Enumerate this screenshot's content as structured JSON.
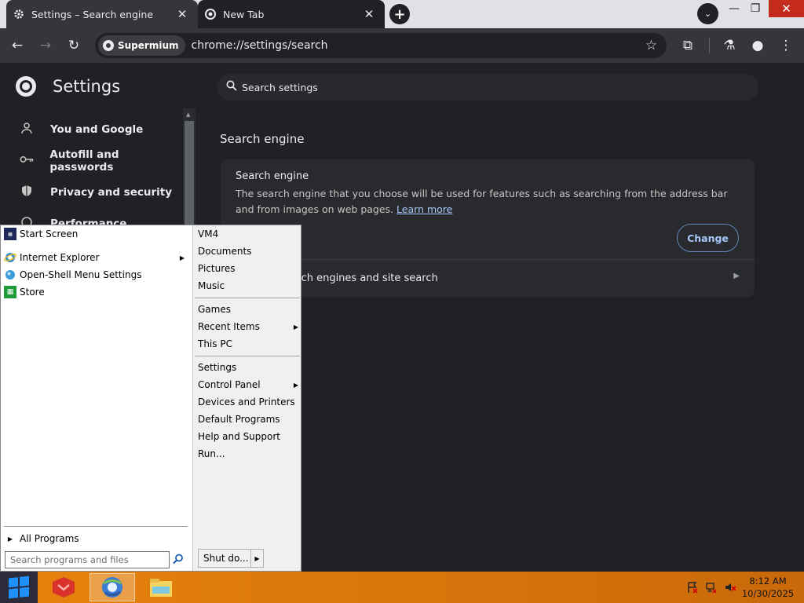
{
  "browser": {
    "tabs": [
      {
        "title": "Settings – Search engine",
        "close": "✕"
      },
      {
        "title": "New Tab",
        "close": "✕"
      }
    ],
    "new_tab": "+",
    "tab_search": "⌄",
    "window_controls": {
      "minimize": "—",
      "restore": "❐",
      "close": "✕"
    },
    "toolbar": {
      "back": "←",
      "forward": "→",
      "reload": "↻",
      "site_chip": "Supermium",
      "url": "chrome://settings/search",
      "bookmark": "☆",
      "extensions": "⧉",
      "labs": "⚗",
      "profile": "●",
      "menu": "⋮"
    }
  },
  "settings": {
    "title": "Settings",
    "search_placeholder": "Search settings",
    "nav": [
      {
        "label": "You and Google",
        "icon": "person-icon"
      },
      {
        "label": "Autofill and passwords",
        "icon": "key-icon"
      },
      {
        "label": "Privacy and security",
        "icon": "shield-icon"
      },
      {
        "label": "Performance",
        "icon": "gauge-icon"
      }
    ],
    "section_title": "Search engine",
    "card": {
      "heading": "Search engine",
      "description": "The search engine that you choose will be used for features such as searching from the address bar and from images on web pages.",
      "learn_more": "Learn more",
      "change_button": "Change",
      "manage_row": "Manage search engines and site search"
    }
  },
  "start_menu": {
    "left_items": [
      {
        "label": "Start Screen",
        "icon": "start-screen-icon"
      },
      {
        "label": "Internet Explorer",
        "icon": "ie-icon",
        "submenu": true
      },
      {
        "label": "Open-Shell Menu Settings",
        "icon": "open-shell-icon"
      },
      {
        "label": "Store",
        "icon": "store-icon"
      }
    ],
    "all_programs": "All Programs",
    "search_placeholder": "Search programs and files",
    "right_items": [
      {
        "label": "VM4"
      },
      {
        "label": "Documents"
      },
      {
        "label": "Pictures"
      },
      {
        "label": "Music"
      },
      {
        "label": "Games"
      },
      {
        "label": "Recent Items",
        "submenu": true
      },
      {
        "label": "This PC"
      },
      {
        "label": "Settings"
      },
      {
        "label": "Control Panel",
        "submenu": true
      },
      {
        "label": "Devices and Printers"
      },
      {
        "label": "Default Programs"
      },
      {
        "label": "Help and Support"
      },
      {
        "label": "Run..."
      }
    ],
    "shutdown": "Shut do..."
  },
  "taskbar": {
    "apps": [
      "app-icon",
      "browser-icon",
      "file-explorer-icon"
    ],
    "clock_time": "8:12 AM",
    "clock_date": "10/30/2025"
  },
  "colors": {
    "accent": "#a8c7fa",
    "taskbar": "#e8820c",
    "close": "#c42b1c"
  }
}
